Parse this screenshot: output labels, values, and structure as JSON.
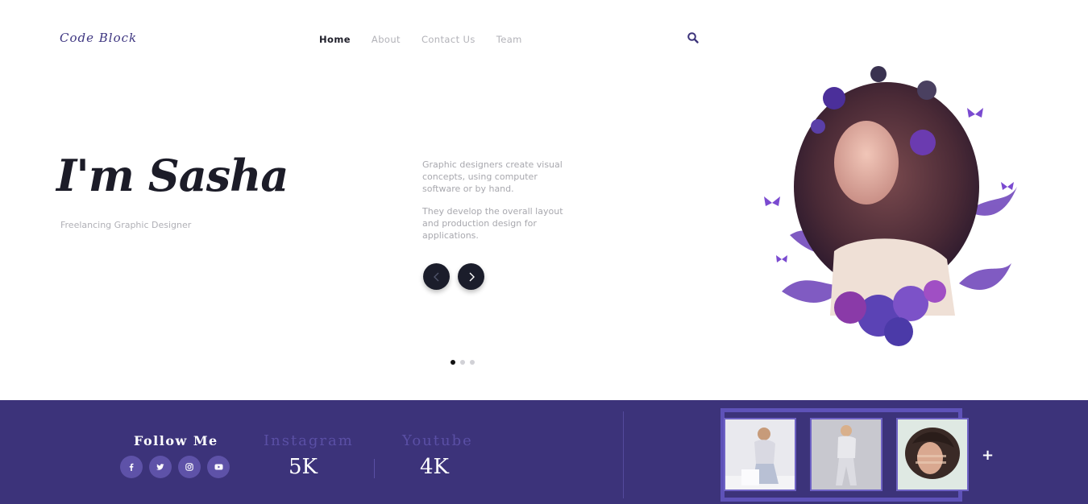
{
  "header": {
    "logo": "Code Block",
    "nav": [
      "Home",
      "About",
      "Contact Us",
      "Team"
    ],
    "active_nav": "Home",
    "search_icon": "search-icon"
  },
  "hero": {
    "title": "I'm Sasha",
    "subtitle": "Freelancing Graphic Designer",
    "description": [
      "Graphic designers create visual concepts, using computer software or by hand.",
      "They develop the overall layout and production design for applications."
    ],
    "slider": {
      "prev_icon": "chevron-left-icon",
      "next_icon": "chevron-right-icon",
      "total": 3,
      "active": 1
    }
  },
  "footer": {
    "follow_title": "Follow Me",
    "socials": [
      "facebook-icon",
      "twitter-icon",
      "instagram-icon",
      "youtube-icon"
    ],
    "stats": [
      {
        "label": "Instagram",
        "value": "5K"
      },
      {
        "label": "Youtube",
        "value": "4K"
      }
    ],
    "more": "+"
  },
  "colors": {
    "brand": "#3c337a",
    "accent": "#5e52a8",
    "dark": "#1b1d2b"
  }
}
